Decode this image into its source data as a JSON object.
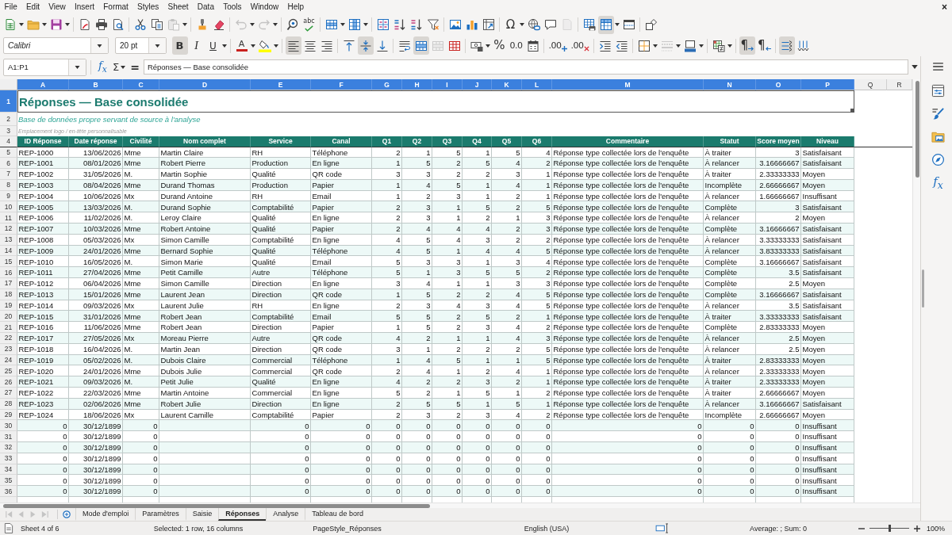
{
  "menu_bar": {
    "items": [
      "File",
      "Edit",
      "View",
      "Insert",
      "Format",
      "Styles",
      "Sheet",
      "Data",
      "Tools",
      "Window",
      "Help"
    ],
    "close": "×"
  },
  "standard_toolbar": [
    {
      "kind": "new",
      "dropdown": true,
      "pressed": false,
      "disabled": false
    },
    {
      "kind": "open",
      "dropdown": true,
      "pressed": false,
      "disabled": false
    },
    {
      "kind": "save",
      "dropdown": true,
      "pressed": false,
      "disabled": false
    },
    {
      "kind": "separator"
    },
    {
      "kind": "export_pdf",
      "dropdown": false,
      "pressed": false,
      "disabled": false
    },
    {
      "kind": "print",
      "dropdown": false,
      "pressed": false,
      "disabled": false
    },
    {
      "kind": "print_preview",
      "dropdown": false,
      "pressed": false,
      "disabled": false
    },
    {
      "kind": "separator"
    },
    {
      "kind": "cut",
      "dropdown": false,
      "pressed": false,
      "disabled": false
    },
    {
      "kind": "copy",
      "dropdown": false,
      "pressed": false,
      "disabled": false
    },
    {
      "kind": "paste",
      "dropdown": true,
      "pressed": false,
      "disabled": true
    },
    {
      "kind": "separator"
    },
    {
      "kind": "clone_formatting",
      "dropdown": false,
      "pressed": false,
      "disabled": false
    },
    {
      "kind": "clear_formatting",
      "dropdown": false,
      "pressed": false,
      "disabled": false
    },
    {
      "kind": "separator"
    },
    {
      "kind": "undo",
      "dropdown": true,
      "pressed": false,
      "disabled": true
    },
    {
      "kind": "redo",
      "dropdown": true,
      "pressed": false,
      "disabled": true
    },
    {
      "kind": "separator"
    },
    {
      "kind": "find_replace",
      "dropdown": false,
      "pressed": false,
      "disabled": false
    },
    {
      "kind": "spelling",
      "label": "abc",
      "dropdown": false,
      "pressed": false,
      "disabled": false
    },
    {
      "kind": "separator"
    },
    {
      "kind": "row",
      "dropdown": true,
      "pressed": false,
      "disabled": false
    },
    {
      "kind": "column",
      "dropdown": true,
      "pressed": false,
      "disabled": false
    },
    {
      "kind": "separator"
    },
    {
      "kind": "sort",
      "dropdown": false,
      "pressed": false,
      "disabled": false
    },
    {
      "kind": "sort_ascending",
      "dropdown": false,
      "pressed": false,
      "disabled": false
    },
    {
      "kind": "sort_descending",
      "dropdown": false,
      "pressed": false,
      "disabled": false
    },
    {
      "kind": "autofilter",
      "dropdown": false,
      "pressed": false,
      "disabled": false
    },
    {
      "kind": "separator"
    },
    {
      "kind": "image",
      "dropdown": false,
      "pressed": false,
      "disabled": false
    },
    {
      "kind": "chart",
      "dropdown": false,
      "pressed": false,
      "disabled": false
    },
    {
      "kind": "pivot_table",
      "dropdown": false,
      "pressed": false,
      "disabled": false
    },
    {
      "kind": "separator"
    },
    {
      "kind": "special_character",
      "label": "Ω",
      "dropdown": true,
      "pressed": false,
      "disabled": false
    },
    {
      "kind": "hyperlink",
      "dropdown": false,
      "pressed": false,
      "disabled": false
    },
    {
      "kind": "comment",
      "dropdown": false,
      "pressed": false,
      "disabled": false
    },
    {
      "kind": "header_footer",
      "dropdown": false,
      "pressed": false,
      "disabled": true
    },
    {
      "kind": "separator"
    },
    {
      "kind": "print_area",
      "dropdown": false,
      "pressed": false,
      "disabled": false
    },
    {
      "kind": "freeze",
      "dropdown": true,
      "pressed": true,
      "disabled": false
    },
    {
      "kind": "split_window",
      "dropdown": false,
      "pressed": false,
      "disabled": false
    },
    {
      "kind": "separator"
    },
    {
      "kind": "draw_functions",
      "dropdown": false,
      "pressed": false,
      "disabled": false
    }
  ],
  "formatting_toolbar": [
    {
      "kind": "font_name",
      "value": "Calibri"
    },
    {
      "kind": "font_size",
      "value": "20 pt"
    },
    {
      "kind": "bold",
      "label": "B",
      "dropdown": false,
      "pressed": true,
      "disabled": false
    },
    {
      "kind": "italic",
      "label": "I",
      "dropdown": false,
      "pressed": false,
      "disabled": false
    },
    {
      "kind": "underline",
      "label": "U",
      "dropdown": true,
      "pressed": false,
      "disabled": false
    },
    {
      "kind": "separator"
    },
    {
      "kind": "font_color",
      "label": "A",
      "dropdown": true,
      "pressed": false,
      "disabled": false
    },
    {
      "kind": "highlight",
      "dropdown": true,
      "pressed": false,
      "disabled": false
    },
    {
      "kind": "separator"
    },
    {
      "kind": "align_left",
      "dropdown": false,
      "pressed": true,
      "disabled": false
    },
    {
      "kind": "align_center",
      "dropdown": false,
      "pressed": false,
      "disabled": false
    },
    {
      "kind": "align_right",
      "dropdown": false,
      "pressed": false,
      "disabled": false
    },
    {
      "kind": "separator"
    },
    {
      "kind": "align_top",
      "dropdown": false,
      "pressed": false,
      "disabled": false
    },
    {
      "kind": "align_middle",
      "dropdown": false,
      "pressed": true,
      "disabled": false
    },
    {
      "kind": "align_bottom",
      "dropdown": false,
      "pressed": false,
      "disabled": false
    },
    {
      "kind": "separator"
    },
    {
      "kind": "wrap_text",
      "dropdown": false,
      "pressed": false,
      "disabled": false
    },
    {
      "kind": "merge_center",
      "dropdown": false,
      "pressed": true,
      "disabled": false
    },
    {
      "kind": "merge",
      "dropdown": false,
      "pressed": false,
      "disabled": true
    },
    {
      "kind": "unmerge",
      "dropdown": false,
      "pressed": false,
      "disabled": false
    },
    {
      "kind": "separator"
    },
    {
      "kind": "currency",
      "dropdown": true,
      "pressed": false,
      "disabled": false
    },
    {
      "kind": "percent",
      "label": "%",
      "dropdown": false,
      "pressed": false,
      "disabled": false
    },
    {
      "kind": "number",
      "label": "0.0",
      "dropdown": false,
      "pressed": false,
      "disabled": false
    },
    {
      "kind": "date",
      "dropdown": false,
      "pressed": false,
      "disabled": false
    },
    {
      "kind": "separator"
    },
    {
      "kind": "add_decimal",
      "label": ".00",
      "dropdown": false,
      "pressed": false,
      "disabled": false
    },
    {
      "kind": "delete_decimal",
      "label": ".00",
      "dropdown": false,
      "pressed": false,
      "disabled": false
    },
    {
      "kind": "separator"
    },
    {
      "kind": "indent_increase",
      "dropdown": false,
      "pressed": false,
      "disabled": false
    },
    {
      "kind": "indent_decrease",
      "dropdown": false,
      "pressed": false,
      "disabled": false
    },
    {
      "kind": "separator"
    },
    {
      "kind": "borders",
      "dropdown": true,
      "pressed": false,
      "disabled": false
    },
    {
      "kind": "border_style",
      "dropdown": true,
      "pressed": false,
      "disabled": true
    },
    {
      "kind": "border_color",
      "dropdown": true,
      "pressed": false,
      "disabled": false
    },
    {
      "kind": "separator"
    },
    {
      "kind": "conditional",
      "dropdown": true,
      "pressed": false,
      "disabled": false
    },
    {
      "kind": "separator"
    },
    {
      "kind": "left_to_right",
      "label": "¶",
      "dropdown": false,
      "pressed": true,
      "disabled": false
    },
    {
      "kind": "right_to_left",
      "label": "¶",
      "dropdown": false,
      "pressed": false,
      "disabled": false
    },
    {
      "kind": "separator"
    },
    {
      "kind": "text_horizontal",
      "dropdown": false,
      "pressed": true,
      "disabled": false
    },
    {
      "kind": "text_vertical",
      "dropdown": false,
      "pressed": false,
      "disabled": false
    }
  ],
  "formula_bar": {
    "name_box": "A1:P1",
    "function_wizard": "f$_{x}$",
    "sum": "Σ",
    "formula": "=",
    "content": "Réponses — Base consolidée"
  },
  "sheet": {
    "columns": [
      {
        "label": "A",
        "selected": true
      },
      {
        "label": "B",
        "selected": true
      },
      {
        "label": "C",
        "selected": true
      },
      {
        "label": "D",
        "selected": true
      },
      {
        "label": "E",
        "selected": true
      },
      {
        "label": "F",
        "selected": true
      },
      {
        "label": "G",
        "selected": true
      },
      {
        "label": "H",
        "selected": true
      },
      {
        "label": "I",
        "selected": true
      },
      {
        "label": "J",
        "selected": true
      },
      {
        "label": "K",
        "selected": true
      },
      {
        "label": "L",
        "selected": true
      },
      {
        "label": "M",
        "selected": true
      },
      {
        "label": "N",
        "selected": true
      },
      {
        "label": "O",
        "selected": true
      },
      {
        "label": "P",
        "selected": true
      },
      {
        "label": "Q",
        "selected": false
      },
      {
        "label": "R",
        "selected": false
      }
    ],
    "title_row": {
      "row": "1",
      "selected": true,
      "text": "Réponses — Base consolidée"
    },
    "subtitle_row": {
      "row": "2",
      "selected": false,
      "text": "Base de données propre servant de source à l'analyse"
    },
    "note_row": {
      "row": "3",
      "selected": false,
      "text": "Emplacement logo / en-tête personnalisable"
    },
    "header_row": {
      "row": "4",
      "selected": false,
      "labels": [
        "ID Réponse",
        "Date réponse",
        "Civilité",
        "Nom complet",
        "Service",
        "Canal",
        "Q1",
        "Q2",
        "Q3",
        "Q4",
        "Q5",
        "Q6",
        "Commentaire",
        "Statut",
        "Score moyen",
        "Niveau"
      ]
    },
    "records": [
      {
        "row": "5",
        "selected": false,
        "kind": "response",
        "id": "REP-1000",
        "date": "13/06/2026",
        "civility": "Mme",
        "full_name": "Martin Claire",
        "service": "RH",
        "channel": "Téléphone",
        "answers": [
          "2",
          "1",
          "5",
          "1",
          "5",
          "4"
        ],
        "comment": "Réponse type collectée lors de l'enquête",
        "status": "À traiter",
        "average_score": "3",
        "rating": "Satisfaisant"
      },
      {
        "row": "6",
        "selected": false,
        "kind": "response",
        "id": "REP-1001",
        "date": "08/01/2026",
        "civility": "Mme",
        "full_name": "Robert Pierre",
        "service": "Production",
        "channel": "En ligne",
        "answers": [
          "1",
          "5",
          "2",
          "5",
          "4",
          "2"
        ],
        "comment": "Réponse type collectée lors de l'enquête",
        "status": "À relancer",
        "average_score": "3.16666667",
        "rating": "Satisfaisant"
      },
      {
        "row": "7",
        "selected": false,
        "kind": "response",
        "id": "REP-1002",
        "date": "31/05/2026",
        "civility": "M.",
        "full_name": "Martin Sophie",
        "service": "Qualité",
        "channel": "QR code",
        "answers": [
          "3",
          "3",
          "2",
          "2",
          "3",
          "1"
        ],
        "comment": "Réponse type collectée lors de l'enquête",
        "status": "À traiter",
        "average_score": "2.33333333",
        "rating": "Moyen"
      },
      {
        "row": "8",
        "selected": false,
        "kind": "response",
        "id": "REP-1003",
        "date": "08/04/2026",
        "civility": "Mme",
        "full_name": "Durand Thomas",
        "service": "Production",
        "channel": "Papier",
        "answers": [
          "1",
          "4",
          "5",
          "1",
          "4",
          "1"
        ],
        "comment": "Réponse type collectée lors de l'enquête",
        "status": "Incomplète",
        "average_score": "2.66666667",
        "rating": "Moyen"
      },
      {
        "row": "9",
        "selected": false,
        "kind": "response",
        "id": "REP-1004",
        "date": "10/06/2026",
        "civility": "Mx",
        "full_name": "Durand Antoine",
        "service": "RH",
        "channel": "Email",
        "answers": [
          "1",
          "2",
          "3",
          "1",
          "2",
          "1"
        ],
        "comment": "Réponse type collectée lors de l'enquête",
        "status": "À relancer",
        "average_score": "1.66666667",
        "rating": "Insuffisant"
      },
      {
        "row": "10",
        "selected": false,
        "kind": "response",
        "id": "REP-1005",
        "date": "13/03/2026",
        "civility": "M.",
        "full_name": "Durand Sophie",
        "service": "Comptabilité",
        "channel": "Papier",
        "answers": [
          "2",
          "3",
          "1",
          "5",
          "2",
          "5"
        ],
        "comment": "Réponse type collectée lors de l'enquête",
        "status": "Complète",
        "average_score": "3",
        "rating": "Satisfaisant"
      },
      {
        "row": "11",
        "selected": false,
        "kind": "response",
        "id": "REP-1006",
        "date": "11/02/2026",
        "civility": "M.",
        "full_name": "Leroy Claire",
        "service": "Qualité",
        "channel": "En ligne",
        "answers": [
          "2",
          "3",
          "1",
          "2",
          "1",
          "3"
        ],
        "comment": "Réponse type collectée lors de l'enquête",
        "status": "À relancer",
        "average_score": "2",
        "rating": "Moyen"
      },
      {
        "row": "12",
        "selected": false,
        "kind": "response",
        "id": "REP-1007",
        "date": "10/03/2026",
        "civility": "Mme",
        "full_name": "Robert Antoine",
        "service": "Qualité",
        "channel": "Papier",
        "answers": [
          "2",
          "4",
          "4",
          "4",
          "2",
          "3"
        ],
        "comment": "Réponse type collectée lors de l'enquête",
        "status": "Complète",
        "average_score": "3.16666667",
        "rating": "Satisfaisant"
      },
      {
        "row": "13",
        "selected": false,
        "kind": "response",
        "id": "REP-1008",
        "date": "05/03/2026",
        "civility": "Mx",
        "full_name": "Simon Camille",
        "service": "Comptabilité",
        "channel": "En ligne",
        "answers": [
          "4",
          "5",
          "4",
          "3",
          "2",
          "2"
        ],
        "comment": "Réponse type collectée lors de l'enquête",
        "status": "À relancer",
        "average_score": "3.33333333",
        "rating": "Satisfaisant"
      },
      {
        "row": "14",
        "selected": false,
        "kind": "response",
        "id": "REP-1009",
        "date": "24/01/2026",
        "civility": "Mme",
        "full_name": "Bernard Sophie",
        "service": "Qualité",
        "channel": "Téléphone",
        "answers": [
          "4",
          "5",
          "1",
          "4",
          "4",
          "5"
        ],
        "comment": "Réponse type collectée lors de l'enquête",
        "status": "À relancer",
        "average_score": "3.83333333",
        "rating": "Satisfaisant"
      },
      {
        "row": "15",
        "selected": false,
        "kind": "response",
        "id": "REP-1010",
        "date": "16/05/2026",
        "civility": "M.",
        "full_name": "Simon Marie",
        "service": "Qualité",
        "channel": "Email",
        "answers": [
          "5",
          "3",
          "3",
          "1",
          "3",
          "4"
        ],
        "comment": "Réponse type collectée lors de l'enquête",
        "status": "Complète",
        "average_score": "3.16666667",
        "rating": "Satisfaisant"
      },
      {
        "row": "16",
        "selected": false,
        "kind": "response",
        "id": "REP-1011",
        "date": "27/04/2026",
        "civility": "Mme",
        "full_name": "Petit Camille",
        "service": "Autre",
        "channel": "Téléphone",
        "answers": [
          "5",
          "1",
          "3",
          "5",
          "5",
          "2"
        ],
        "comment": "Réponse type collectée lors de l'enquête",
        "status": "Complète",
        "average_score": "3.5",
        "rating": "Satisfaisant"
      },
      {
        "row": "17",
        "selected": false,
        "kind": "response",
        "id": "REP-1012",
        "date": "06/04/2026",
        "civility": "Mme",
        "full_name": "Simon Camille",
        "service": "Direction",
        "channel": "En ligne",
        "answers": [
          "3",
          "4",
          "1",
          "1",
          "3",
          "3"
        ],
        "comment": "Réponse type collectée lors de l'enquête",
        "status": "Complète",
        "average_score": "2.5",
        "rating": "Moyen"
      },
      {
        "row": "18",
        "selected": false,
        "kind": "response",
        "id": "REP-1013",
        "date": "15/01/2026",
        "civility": "Mme",
        "full_name": "Laurent Jean",
        "service": "Direction",
        "channel": "QR code",
        "answers": [
          "1",
          "5",
          "2",
          "2",
          "4",
          "5"
        ],
        "comment": "Réponse type collectée lors de l'enquête",
        "status": "Complète",
        "average_score": "3.16666667",
        "rating": "Satisfaisant"
      },
      {
        "row": "19",
        "selected": false,
        "kind": "response",
        "id": "REP-1014",
        "date": "09/03/2026",
        "civility": "Mx",
        "full_name": "Laurent Julie",
        "service": "RH",
        "channel": "En ligne",
        "answers": [
          "2",
          "3",
          "4",
          "3",
          "4",
          "5"
        ],
        "comment": "Réponse type collectée lors de l'enquête",
        "status": "À relancer",
        "average_score": "3.5",
        "rating": "Satisfaisant"
      },
      {
        "row": "20",
        "selected": false,
        "kind": "response",
        "id": "REP-1015",
        "date": "31/01/2026",
        "civility": "Mme",
        "full_name": "Robert Jean",
        "service": "Comptabilité",
        "channel": "Email",
        "answers": [
          "5",
          "5",
          "2",
          "5",
          "2",
          "1"
        ],
        "comment": "Réponse type collectée lors de l'enquête",
        "status": "À traiter",
        "average_score": "3.33333333",
        "rating": "Satisfaisant"
      },
      {
        "row": "21",
        "selected": false,
        "kind": "response",
        "id": "REP-1016",
        "date": "11/06/2026",
        "civility": "Mme",
        "full_name": "Robert Jean",
        "service": "Direction",
        "channel": "Papier",
        "answers": [
          "1",
          "5",
          "2",
          "3",
          "4",
          "2"
        ],
        "comment": "Réponse type collectée lors de l'enquête",
        "status": "Complète",
        "average_score": "2.83333333",
        "rating": "Moyen"
      },
      {
        "row": "22",
        "selected": false,
        "kind": "response",
        "id": "REP-1017",
        "date": "27/05/2026",
        "civility": "Mx",
        "full_name": "Moreau Pierre",
        "service": "Autre",
        "channel": "QR code",
        "answers": [
          "4",
          "2",
          "1",
          "1",
          "4",
          "3"
        ],
        "comment": "Réponse type collectée lors de l'enquête",
        "status": "À relancer",
        "average_score": "2.5",
        "rating": "Moyen"
      },
      {
        "row": "23",
        "selected": false,
        "kind": "response",
        "id": "REP-1018",
        "date": "16/04/2026",
        "civility": "M.",
        "full_name": "Martin Jean",
        "service": "Direction",
        "channel": "QR code",
        "answers": [
          "3",
          "1",
          "2",
          "2",
          "2",
          "5"
        ],
        "comment": "Réponse type collectée lors de l'enquête",
        "status": "À relancer",
        "average_score": "2.5",
        "rating": "Moyen"
      },
      {
        "row": "24",
        "selected": false,
        "kind": "response",
        "id": "REP-1019",
        "date": "05/02/2026",
        "civility": "M.",
        "full_name": "Dubois Claire",
        "service": "Commercial",
        "channel": "Téléphone",
        "answers": [
          "1",
          "4",
          "5",
          "1",
          "1",
          "5"
        ],
        "comment": "Réponse type collectée lors de l'enquête",
        "status": "À traiter",
        "average_score": "2.83333333",
        "rating": "Moyen"
      },
      {
        "row": "25",
        "selected": false,
        "kind": "response",
        "id": "REP-1020",
        "date": "24/01/2026",
        "civility": "Mme",
        "full_name": "Dubois Julie",
        "service": "Commercial",
        "channel": "QR code",
        "answers": [
          "2",
          "4",
          "1",
          "2",
          "4",
          "1"
        ],
        "comment": "Réponse type collectée lors de l'enquête",
        "status": "À relancer",
        "average_score": "2.33333333",
        "rating": "Moyen"
      },
      {
        "row": "26",
        "selected": false,
        "kind": "response",
        "id": "REP-1021",
        "date": "09/03/2026",
        "civility": "M.",
        "full_name": "Petit Julie",
        "service": "Qualité",
        "channel": "En ligne",
        "answers": [
          "4",
          "2",
          "2",
          "3",
          "2",
          "1"
        ],
        "comment": "Réponse type collectée lors de l'enquête",
        "status": "À traiter",
        "average_score": "2.33333333",
        "rating": "Moyen"
      },
      {
        "row": "27",
        "selected": false,
        "kind": "response",
        "id": "REP-1022",
        "date": "22/03/2026",
        "civility": "Mme",
        "full_name": "Martin Antoine",
        "service": "Commercial",
        "channel": "En ligne",
        "answers": [
          "5",
          "2",
          "1",
          "5",
          "1",
          "2"
        ],
        "comment": "Réponse type collectée lors de l'enquête",
        "status": "À traiter",
        "average_score": "2.66666667",
        "rating": "Moyen"
      },
      {
        "row": "28",
        "selected": false,
        "kind": "response",
        "id": "REP-1023",
        "date": "02/06/2026",
        "civility": "Mme",
        "full_name": "Robert Julie",
        "service": "Direction",
        "channel": "En ligne",
        "answers": [
          "2",
          "5",
          "5",
          "1",
          "5",
          "1"
        ],
        "comment": "Réponse type collectée lors de l'enquête",
        "status": "À relancer",
        "average_score": "3.16666667",
        "rating": "Satisfaisant"
      },
      {
        "row": "29",
        "selected": false,
        "kind": "response",
        "id": "REP-1024",
        "date": "18/06/2026",
        "civility": "Mx",
        "full_name": "Laurent Camille",
        "service": "Comptabilité",
        "channel": "Papier",
        "answers": [
          "2",
          "3",
          "2",
          "3",
          "4",
          "2"
        ],
        "comment": "Réponse type collectée lors de l'enquête",
        "status": "Incomplète",
        "average_score": "2.66666667",
        "rating": "Moyen"
      },
      {
        "row": "30",
        "selected": false,
        "kind": "blank",
        "id": "0",
        "date": "30/12/1899",
        "civility": "0",
        "service": "0",
        "channel": "0",
        "answers": [
          "0",
          "0",
          "0",
          "0",
          "0",
          "0"
        ],
        "comment": "0",
        "status": "0",
        "average_score": "0",
        "rating": "Insuffisant"
      },
      {
        "row": "31",
        "selected": false,
        "kind": "blank",
        "id": "0",
        "date": "30/12/1899",
        "civility": "0",
        "service": "0",
        "channel": "0",
        "answers": [
          "0",
          "0",
          "0",
          "0",
          "0",
          "0"
        ],
        "comment": "0",
        "status": "0",
        "average_score": "0",
        "rating": "Insuffisant"
      },
      {
        "row": "32",
        "selected": false,
        "kind": "blank",
        "id": "0",
        "date": "30/12/1899",
        "civility": "0",
        "service": "0",
        "channel": "0",
        "answers": [
          "0",
          "0",
          "0",
          "0",
          "0",
          "0"
        ],
        "comment": "0",
        "status": "0",
        "average_score": "0",
        "rating": "Insuffisant"
      },
      {
        "row": "33",
        "selected": false,
        "kind": "blank",
        "id": "0",
        "date": "30/12/1899",
        "civility": "0",
        "service": "0",
        "channel": "0",
        "answers": [
          "0",
          "0",
          "0",
          "0",
          "0",
          "0"
        ],
        "comment": "0",
        "status": "0",
        "average_score": "0",
        "rating": "Insuffisant"
      },
      {
        "row": "34",
        "selected": false,
        "kind": "blank",
        "id": "0",
        "date": "30/12/1899",
        "civility": "0",
        "service": "0",
        "channel": "0",
        "answers": [
          "0",
          "0",
          "0",
          "0",
          "0",
          "0"
        ],
        "comment": "0",
        "status": "0",
        "average_score": "0",
        "rating": "Insuffisant"
      },
      {
        "row": "35",
        "selected": false,
        "kind": "blank",
        "id": "0",
        "date": "30/12/1899",
        "civility": "0",
        "service": "0",
        "channel": "0",
        "answers": [
          "0",
          "0",
          "0",
          "0",
          "0",
          "0"
        ],
        "comment": "0",
        "status": "0",
        "average_score": "0",
        "rating": "Insuffisant"
      },
      {
        "row": "36",
        "selected": false,
        "kind": "blank",
        "id": "0",
        "date": "30/12/1899",
        "civility": "0",
        "service": "0",
        "channel": "0",
        "answers": [
          "0",
          "0",
          "0",
          "0",
          "0",
          "0"
        ],
        "comment": "0",
        "status": "0",
        "average_score": "0",
        "rating": "Insuffisant"
      }
    ]
  },
  "sidebar": {
    "decks": [
      {
        "kind": "properties",
        "selected": false
      },
      {
        "kind": "styles",
        "selected": false
      },
      {
        "kind": "gallery",
        "selected": false
      },
      {
        "kind": "navigator",
        "selected": false
      },
      {
        "kind": "functions",
        "label": "f$_{x}$",
        "selected": false
      }
    ]
  },
  "sheet_tabs": {
    "navigation_disabled": true,
    "tabs": [
      {
        "label": "Mode d'emploi",
        "selected": false
      },
      {
        "label": "Paramètres",
        "selected": false
      },
      {
        "label": "Saisie",
        "selected": false
      },
      {
        "label": "Réponses",
        "selected": true
      },
      {
        "label": "Analyse",
        "selected": false
      },
      {
        "label": "Tableau de bord",
        "selected": false
      }
    ]
  },
  "status_bar": {
    "sheet": "Sheet 4 of 6",
    "selection": "Selected: 1 row, 16 columns",
    "page_style": "PageStyle_Réponses",
    "language": "English (USA)",
    "summary": "Average: ; Sum: 0",
    "zoom": {
      "label": "100%",
      "level": 0.5
    }
  }
}
